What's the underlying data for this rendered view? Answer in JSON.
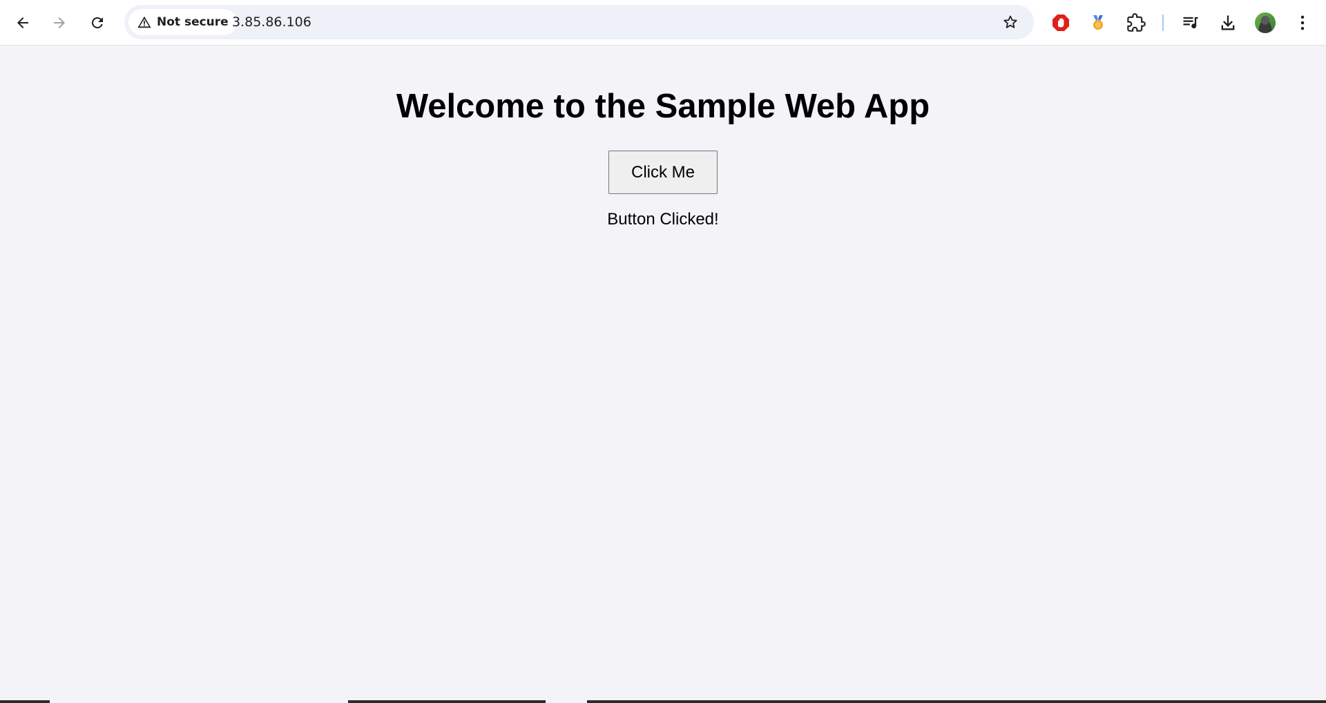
{
  "browser": {
    "security_label": "Not secure",
    "url": "3.85.86.106",
    "buttons": {
      "back": "back-arrow-icon",
      "forward": "forward-arrow-icon",
      "reload": "reload-icon",
      "bookmark": "star-icon",
      "adblock": "stop-hand-icon",
      "rewards": "medal-icon",
      "extensions": "puzzle-piece-icon",
      "media": "media-queue-icon",
      "downloads": "download-icon",
      "profile": "avatar",
      "menu": "three-dot-menu-icon"
    },
    "colors": {
      "adblock": "#e0201a",
      "rewards_ribbon": "#4f86f7",
      "rewards_medal": "#f5a623",
      "divider": "#a8c7fa"
    }
  },
  "page": {
    "heading": "Welcome to the Sample Web App",
    "button_label": "Click Me",
    "result_text": "Button Clicked!",
    "background": "#f3f3f8"
  }
}
